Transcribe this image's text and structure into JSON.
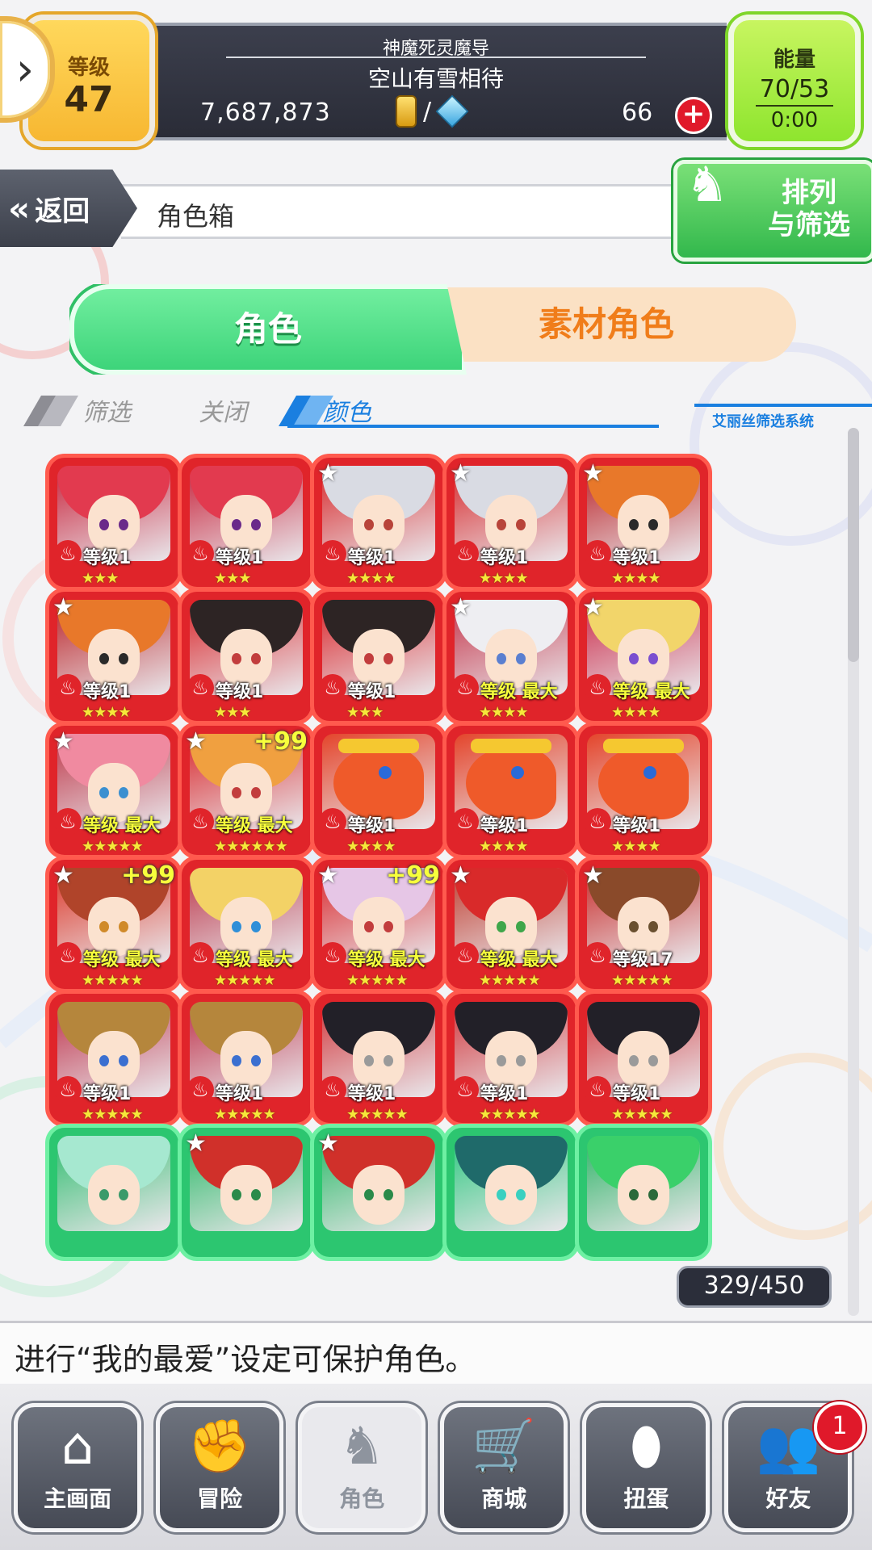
{
  "header": {
    "level_label": "等级",
    "level_value": "47",
    "title": "神魔死灵魔导",
    "name": "空山有雪相待",
    "coins": "7,687,873",
    "separator": "/",
    "gems": "66",
    "plus": "+",
    "energy_label": "能量",
    "energy_value": "70/53",
    "energy_time": "0:00"
  },
  "nav": {
    "back_label": "返回",
    "breadcrumb": "角色箱",
    "sort_label_1": "排列",
    "sort_label_2": "与筛选"
  },
  "tabs": {
    "characters": "角色",
    "materials": "素材角色"
  },
  "filter": {
    "select": "筛选",
    "off": "关闭",
    "color": "颜色",
    "system": "艾丽丝筛选系统"
  },
  "cards": [
    {
      "theme": "red-hair",
      "star": false,
      "plus": "",
      "level": "等级1",
      "max": false,
      "rarity": "★★★"
    },
    {
      "theme": "red-hair",
      "star": false,
      "plus": "",
      "level": "等级1",
      "max": false,
      "rarity": "★★★"
    },
    {
      "theme": "silver-hair",
      "star": true,
      "plus": "",
      "level": "等级1",
      "max": false,
      "rarity": "★★★★"
    },
    {
      "theme": "silver-hair",
      "star": true,
      "plus": "",
      "level": "等级1",
      "max": false,
      "rarity": "★★★★"
    },
    {
      "theme": "orange-hair",
      "star": true,
      "plus": "",
      "level": "等级1",
      "max": false,
      "rarity": "★★★★"
    },
    {
      "theme": "orange-hair",
      "star": true,
      "plus": "",
      "level": "等级1",
      "max": false,
      "rarity": "★★★★"
    },
    {
      "theme": "black-hair",
      "star": false,
      "plus": "",
      "level": "等级1",
      "max": false,
      "rarity": "★★★"
    },
    {
      "theme": "black-hair",
      "star": false,
      "plus": "",
      "level": "等级1",
      "max": false,
      "rarity": "★★★"
    },
    {
      "theme": "white-hair",
      "star": true,
      "plus": "",
      "level": "等级 最大",
      "max": true,
      "rarity": "★★★★"
    },
    {
      "theme": "blonde-hat",
      "star": true,
      "plus": "",
      "level": "等级 最大",
      "max": true,
      "rarity": "★★★★"
    },
    {
      "theme": "pink-hair",
      "star": true,
      "plus": "",
      "level": "等级 最大",
      "max": true,
      "rarity": "★★★★★"
    },
    {
      "theme": "ginger-hair",
      "star": true,
      "plus": "+99",
      "level": "等级 最大",
      "max": true,
      "rarity": "★★★★★★"
    },
    {
      "theme": "dragon",
      "star": false,
      "plus": "",
      "level": "等级1",
      "max": false,
      "rarity": "★★★★"
    },
    {
      "theme": "dragon",
      "star": false,
      "plus": "",
      "level": "等级1",
      "max": false,
      "rarity": "★★★★"
    },
    {
      "theme": "dragon",
      "star": false,
      "plus": "",
      "level": "等级1",
      "max": false,
      "rarity": "★★★★"
    },
    {
      "theme": "brown-hair",
      "star": true,
      "plus": "+99",
      "level": "等级 最大",
      "max": true,
      "rarity": "★★★★★"
    },
    {
      "theme": "blonde-goggles",
      "star": false,
      "plus": "",
      "level": "等级 最大",
      "max": true,
      "rarity": "★★★★★"
    },
    {
      "theme": "lilac-hair",
      "star": true,
      "plus": "+99",
      "level": "等级 最大",
      "max": true,
      "rarity": "★★★★★"
    },
    {
      "theme": "crimson-hair",
      "star": true,
      "plus": "",
      "level": "等级 最大",
      "max": true,
      "rarity": "★★★★★"
    },
    {
      "theme": "headphones",
      "star": true,
      "plus": "",
      "level": "等级17",
      "max": false,
      "rarity": "★★★★★"
    },
    {
      "theme": "tan-hair",
      "star": false,
      "plus": "",
      "level": "等级1",
      "max": false,
      "rarity": "★★★★★"
    },
    {
      "theme": "tan-hair",
      "star": false,
      "plus": "",
      "level": "等级1",
      "max": false,
      "rarity": "★★★★★"
    },
    {
      "theme": "bob-hair",
      "star": false,
      "plus": "",
      "level": "等级1",
      "max": false,
      "rarity": "★★★★★"
    },
    {
      "theme": "bob-hair",
      "star": false,
      "plus": "",
      "level": "等级1",
      "max": false,
      "rarity": "★★★★★"
    },
    {
      "theme": "bob-hair",
      "star": false,
      "plus": "",
      "level": "等级1",
      "max": false,
      "rarity": "★★★★★"
    },
    {
      "theme": "mint-hair",
      "star": false,
      "plus": "",
      "level": "",
      "max": false,
      "rarity": "",
      "green": true
    },
    {
      "theme": "rose-hair",
      "star": true,
      "plus": "",
      "level": "",
      "max": false,
      "rarity": "",
      "green": true
    },
    {
      "theme": "rose-hair",
      "star": true,
      "plus": "",
      "level": "",
      "max": false,
      "rarity": "",
      "green": true
    },
    {
      "theme": "teal-armor",
      "star": false,
      "plus": "",
      "level": "",
      "max": false,
      "rarity": "",
      "green": true
    },
    {
      "theme": "green-hair",
      "star": false,
      "plus": "",
      "level": "",
      "max": false,
      "rarity": "",
      "green": true
    }
  ],
  "box_count": "329/450",
  "hint": "进行“我的最爱”设定可保护角色。",
  "bottom_nav": [
    {
      "label": "主画面",
      "icon": "home-icon",
      "glyph": "⌂"
    },
    {
      "label": "冒险",
      "icon": "handshake-icon",
      "glyph": "✊"
    },
    {
      "label": "角色",
      "icon": "bunny-icon",
      "glyph": "♞"
    },
    {
      "label": "商城",
      "icon": "cart-icon",
      "glyph": "🛒"
    },
    {
      "label": "扭蛋",
      "icon": "egg-icon",
      "glyph": "⬮"
    },
    {
      "label": "好友",
      "icon": "friends-icon",
      "glyph": "👥"
    }
  ],
  "friends_badge": "1",
  "colors": {
    "card_red": "#e0242a",
    "card_green": "#2cc670",
    "accent_green": "#3dd47a",
    "accent_orange": "#f07d1a",
    "filter_blue": "#1a7fe0"
  }
}
